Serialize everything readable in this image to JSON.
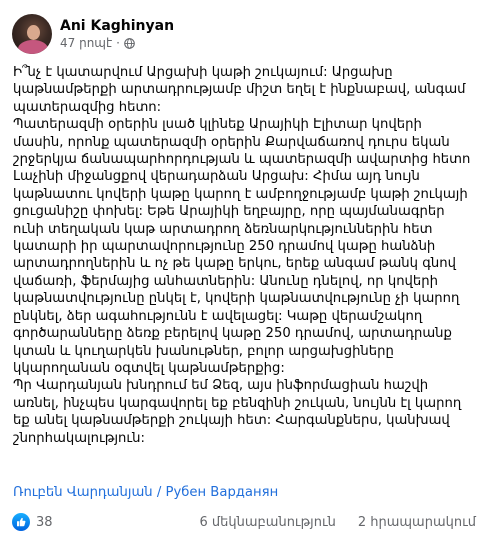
{
  "post": {
    "author": "Ani Kaghinyan",
    "time": "47 րոպէ",
    "privacy_icon": "globe-icon",
    "paragraphs": [
      "Ի՞նչ է կատարվում Արցախի կաթի շուկայում: Արցախը կաթնամթերքի արտադրությամբ միշտ եղել է ինքնաբավ, անգամ պատերազմից հետո:",
      "Պատերազմի օրերին լսած կլինեք Արայիկի Էլիտար կովերի մասին, որոնք պատերազմի օրերին Քարվաճառով դուրս եկան շրջերկյա ճանապարհորդության և պատերազմի ավարտից հետո Լաչինի միջանցքով վերադարձան Արցախ: Հիմա այդ նույն կաթնատու կովերի կաթը կարող է ամբողջությամբ կաթի շուկայի ցուցանիշը փոխել: Եթե Արայիկի եղբայրը, որը պայմանագրեր ունի տեղական կաթ արտադրող ձեռնարկություններին հետ կատարի իր պարտավորությունը 250 դրամով կաթը հանձնի արտադրողներին և ոչ թե կաթը երկու, երեք անգամ թանկ գնով վաճառի, ֆերմայից անհատներին: Անունը դնելով, որ կովերի կաթնատվությունը ընկել է, կովերի կաթնատվությունը չի կարող ընկնել, ձեր ագահությունն է ավելացել: Կաթը վերամշակող գործարանները ձեռք բերելով կաթը 250 դրամով, արտադրանք կտան և կուղարկեն խանութներ, բոլոր արցախցիները կկարողանան օգտվել կաթնամթերքից:",
      "Պր Վարդանյան խնդրում եմ Ձեզ, այս ինֆորմացիան հաշվի առնել, ինչպես կարգավորել եք բենզինի շուկան, նույնն էլ կարող եք անել կաթնամթերքի շուկայի հետ: Հարգանքներս, կանխավ շնորհակալություն:"
    ],
    "signature": "Ռուբեն Վարդանյան / Рубен Варданян",
    "likes": "38",
    "comments": "6 մեկնաբանություն",
    "shares": "2 հրապարակում",
    "colors": {
      "link": "#216fdb",
      "muted": "#65676b",
      "like_blue": "#0062df"
    }
  }
}
